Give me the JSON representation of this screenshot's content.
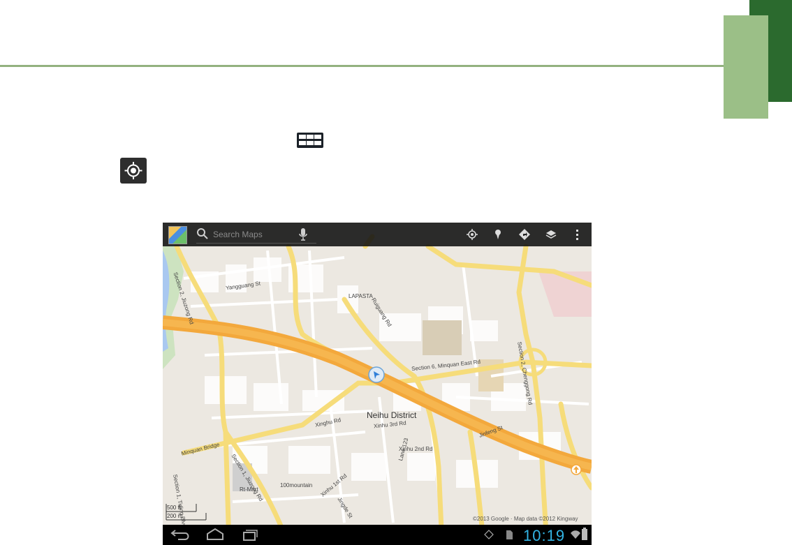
{
  "map": {
    "search_placeholder": "Search Maps",
    "district_label": "Neihu District",
    "copyright": "©2013 Google · Map data ©2012 Kingway",
    "scale": {
      "top": "500 ft",
      "bottom": "200 m"
    },
    "street_labels": [
      "Section 2, Jiuzong Rd",
      "Yangguang St",
      "Ruiguang Rd",
      "LAPASTA",
      "Section 6, Minquan East Rd",
      "Section 2, Chenggong Rd",
      "Xinghu Rd",
      "Xinhu 3rd Rd",
      "Minquan Bridge",
      "Section 1, Jiuzong Rd",
      "Xinhu 2nd Rd",
      "Jinfeng St",
      "Section 1, Tiding Blvd",
      "100mountain",
      "Rt-Mart",
      "Xinhu 1st Rd",
      "Jingde St",
      "Lane 123"
    ]
  },
  "actionbar": {
    "icons": [
      "google-maps-logo-icon",
      "search-icon",
      "microphone-icon",
      "my-location-icon",
      "place-pin-icon",
      "directions-icon",
      "layers-icon",
      "overflow-menu-icon"
    ]
  },
  "statusbar": {
    "time": "10:19"
  },
  "colors": {
    "page_rule": "#93b17f",
    "tab_dark": "#2b6a2e",
    "tab_light": "#9bbf87",
    "map_bg": "#ece8e1",
    "major_road": "#f3a83c",
    "road": "#f8e38a",
    "clock": "#33b5e5"
  }
}
